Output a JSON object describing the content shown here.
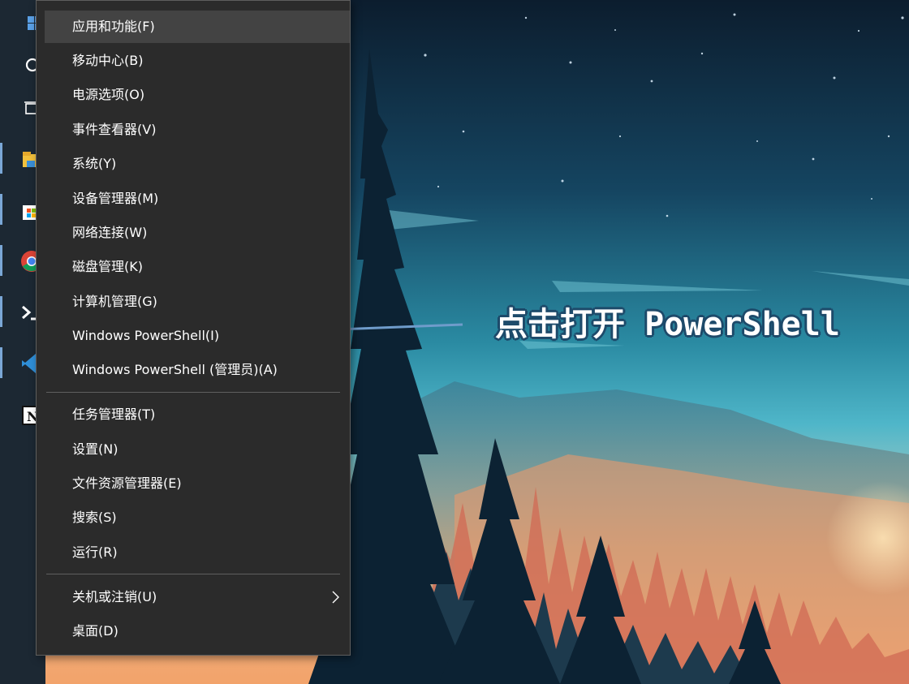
{
  "desktop": {
    "annotation_text": "点击打开 PowerShell",
    "colors": {
      "sky_top": "#0c1d2e",
      "sky_mid": "#1d5f7a",
      "sky_low": "#4fb6c9",
      "sunset": "#f2a36b",
      "tree_dark": "#0c2233",
      "arrow": "#6f9ccb"
    }
  },
  "taskbar": {
    "icons": [
      {
        "name": "windows-start-icon",
        "active": false
      },
      {
        "name": "search-icon",
        "active": false
      },
      {
        "name": "task-view-icon",
        "active": false
      },
      {
        "name": "file-explorer-icon",
        "active": true
      },
      {
        "name": "microsoft-store-icon",
        "active": true
      },
      {
        "name": "chrome-icon",
        "active": true
      },
      {
        "name": "terminal-icon",
        "active": true
      },
      {
        "name": "vscode-icon",
        "active": true
      },
      {
        "name": "notion-icon",
        "active": false
      }
    ]
  },
  "context_menu": {
    "group1": [
      {
        "label": "应用和功能(F)",
        "highlighted": true
      },
      {
        "label": "移动中心(B)"
      },
      {
        "label": "电源选项(O)"
      },
      {
        "label": "事件查看器(V)"
      },
      {
        "label": "系统(Y)"
      },
      {
        "label": "设备管理器(M)"
      },
      {
        "label": "网络连接(W)"
      },
      {
        "label": "磁盘管理(K)"
      },
      {
        "label": "计算机管理(G)"
      },
      {
        "label": "Windows PowerShell(I)"
      },
      {
        "label": "Windows PowerShell (管理员)(A)"
      }
    ],
    "group2": [
      {
        "label": "任务管理器(T)"
      },
      {
        "label": "设置(N)"
      },
      {
        "label": "文件资源管理器(E)"
      },
      {
        "label": "搜索(S)"
      },
      {
        "label": "运行(R)"
      }
    ],
    "group3": [
      {
        "label": "关机或注销(U)",
        "submenu": true,
        "icon": "chevron-right-icon"
      },
      {
        "label": "桌面(D)"
      }
    ]
  }
}
